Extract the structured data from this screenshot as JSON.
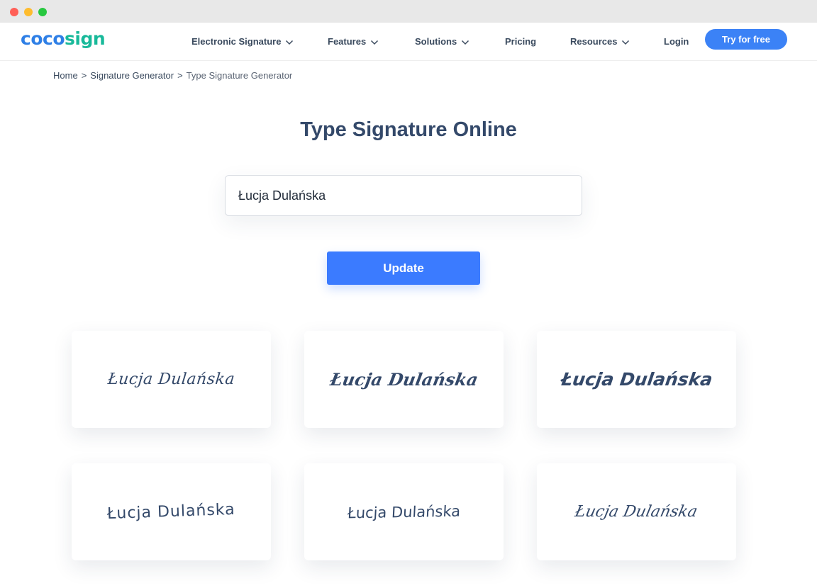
{
  "brand": {
    "logo_part1": "coco",
    "logo_part2": "sign",
    "colors": {
      "logo_blue": "#2e7fe6",
      "logo_teal": "#18b99a",
      "primary": "#3b7bff",
      "heading": "#34496a"
    }
  },
  "nav": {
    "items": [
      {
        "label": "Electronic Signature",
        "has_dropdown": true
      },
      {
        "label": "Features",
        "has_dropdown": true
      },
      {
        "label": "Solutions",
        "has_dropdown": true
      },
      {
        "label": "Pricing",
        "has_dropdown": false
      },
      {
        "label": "Resources",
        "has_dropdown": true
      },
      {
        "label": "Login",
        "has_dropdown": false
      }
    ],
    "cta_label": "Try for free"
  },
  "breadcrumb": {
    "items": [
      "Home",
      "Signature Generator",
      "Type Signature Generator"
    ],
    "separator": ">"
  },
  "main": {
    "title": "Type Signature Online",
    "input_value": "Łucja Dulańska",
    "update_label": "Update"
  },
  "signatures": [
    {
      "text": "Łucja Dulańska"
    },
    {
      "text": "Łucja Dulańska"
    },
    {
      "text": "Łucja Dulańska"
    },
    {
      "text": "Łucja Dulańska"
    },
    {
      "text": "Łucja Dulańska"
    },
    {
      "text": "Łucja Dulańska"
    }
  ]
}
